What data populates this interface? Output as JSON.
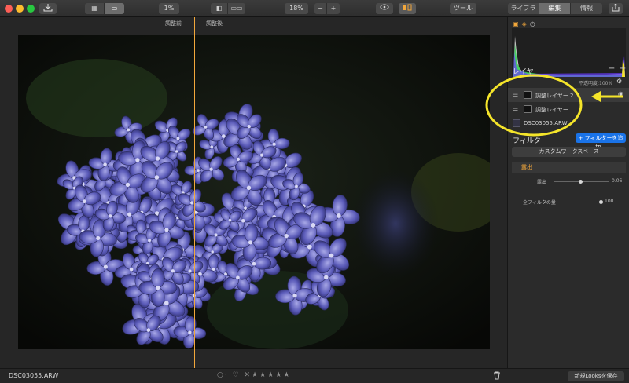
{
  "toolbar": {
    "zoom_small": "1%",
    "zoom": "18%",
    "minus": "−",
    "plus": "+",
    "tools_label": "ツール",
    "tabs": [
      "ライブラリ",
      "編集",
      "情報"
    ]
  },
  "canvas": {
    "before_label": "調整前",
    "after_label": "調整後"
  },
  "panel": {
    "layers_title": "レイヤー",
    "opacity_label": "不透明度:100%",
    "layers": [
      {
        "label": "調整レイヤー 2",
        "selected": true
      },
      {
        "label": "調整レイヤー 1",
        "selected": false
      },
      {
        "label": "DSC03055.ARW",
        "selected": false
      }
    ],
    "filters_title": "フィルター",
    "add_filter": "+ フィルターを追加...",
    "workspace": "カスタムワークスペース",
    "exposure_section": "露出",
    "exposure_label": "露出",
    "exposure_value": "0.06",
    "overall_label": "全フィルタの量",
    "overall_value": "100"
  },
  "bottom": {
    "filename": "DSC03055.ARW",
    "rating_icons": "○· ♡ ✕★★★★★",
    "save_look": "新規Looksを保存"
  },
  "colors": {
    "accent_orange": "#f2a73b",
    "accent_blue": "#1a73e8",
    "annotation_yellow": "#f5e52a"
  }
}
